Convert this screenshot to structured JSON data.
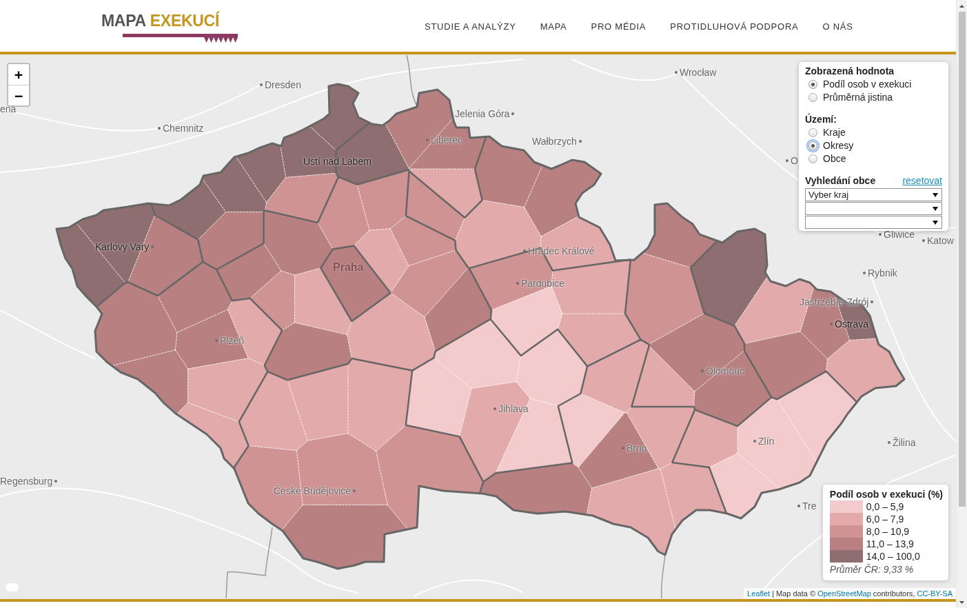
{
  "header": {
    "logo": {
      "first_word": "MAPA",
      "second_word": "EXEKUCÍ"
    },
    "nav": [
      {
        "label": "STUDIE A ANALÝZY"
      },
      {
        "label": "MAPA"
      },
      {
        "label": "PRO MÉDIA"
      },
      {
        "label": "PROTIDLUHOVÁ PODPORA"
      },
      {
        "label": "O NÁS"
      }
    ]
  },
  "map": {
    "zoom_controls": [
      {
        "label": "+"
      },
      {
        "label": "−"
      }
    ],
    "labels": [
      {
        "text": "Wrocław",
        "kind": "city"
      },
      {
        "text": "Dresden",
        "kind": "city"
      },
      {
        "text": "ena",
        "kind": "city"
      },
      {
        "text": "Jelenia Góra",
        "kind": "city"
      },
      {
        "text": "Chemnitz",
        "kind": "city"
      },
      {
        "text": "Liberec",
        "kind": "city"
      },
      {
        "text": "Wałbrzych",
        "kind": "city"
      },
      {
        "text": "O",
        "kind": "city"
      },
      {
        "text": "Ústí nad Labem",
        "kind": "city"
      },
      {
        "text": "Gliwice",
        "kind": "city"
      },
      {
        "text": "Katow",
        "kind": "city"
      },
      {
        "text": "Karlovy Vary",
        "kind": "city"
      },
      {
        "text": "Hradec Králové",
        "kind": "city"
      },
      {
        "text": "Praha",
        "kind": "capital"
      },
      {
        "text": "Rybnik",
        "kind": "city"
      },
      {
        "text": "Pardubice",
        "kind": "city"
      },
      {
        "text": "Jastrzębie-Zdrój",
        "kind": "city"
      },
      {
        "text": "Ostrava",
        "kind": "city"
      },
      {
        "text": "Plzeň",
        "kind": "city"
      },
      {
        "text": "Olomouc",
        "kind": "city"
      },
      {
        "text": "Jihlava",
        "kind": "city"
      },
      {
        "text": "Zlín",
        "kind": "city"
      },
      {
        "text": "Žilina",
        "kind": "city"
      },
      {
        "text": "Brno",
        "kind": "city"
      },
      {
        "text": "Regensburg",
        "kind": "city"
      },
      {
        "text": "České Budějovice",
        "kind": "city"
      },
      {
        "text": "Tre",
        "kind": "city"
      }
    ],
    "districts": [
      {
        "color": "#8f6e70"
      },
      {
        "color": "#8f6e70"
      },
      {
        "color": "#b98082"
      },
      {
        "color": "#8f6e70"
      },
      {
        "color": "#8f6e70"
      },
      {
        "color": "#8f6e70"
      },
      {
        "color": "#8f6e70"
      },
      {
        "color": "#8f6e70"
      },
      {
        "color": "#b98082"
      },
      {
        "color": "#d09394"
      },
      {
        "color": "#8f6e70"
      },
      {
        "color": "#b98082"
      },
      {
        "color": "#b98082"
      },
      {
        "color": "#e3aaab"
      },
      {
        "color": "#d09394"
      },
      {
        "color": "#b98082"
      },
      {
        "color": "#b98082"
      },
      {
        "color": "#e3aaab"
      },
      {
        "color": "#e3aaab"
      },
      {
        "color": "#d09394"
      },
      {
        "color": "#f4cbcc"
      },
      {
        "color": "#e3aaab"
      },
      {
        "color": "#e3aaab"
      },
      {
        "color": "#b98082"
      },
      {
        "color": "#b98082"
      },
      {
        "color": "#d09394"
      },
      {
        "color": "#d09394"
      },
      {
        "color": "#d09394"
      },
      {
        "color": "#e3aaab"
      },
      {
        "color": "#e3aaab"
      },
      {
        "color": "#d09394"
      },
      {
        "color": "#d09394"
      },
      {
        "color": "#b98082"
      },
      {
        "color": "#e3aaab"
      },
      {
        "color": "#b98082"
      },
      {
        "color": "#b98082"
      },
      {
        "color": "#b98082"
      },
      {
        "color": "#b98082"
      },
      {
        "color": "#b98082"
      },
      {
        "color": "#b98082"
      },
      {
        "color": "#e3aaab"
      },
      {
        "color": "#e3aaab"
      },
      {
        "color": "#e3aaab"
      },
      {
        "color": "#e3aaab"
      },
      {
        "color": "#e3aaab"
      },
      {
        "color": "#e3aaab"
      },
      {
        "color": "#d09394"
      },
      {
        "color": "#d09394"
      },
      {
        "color": "#b98082"
      },
      {
        "color": "#d09394"
      },
      {
        "color": "#f4cbcc"
      },
      {
        "color": "#f4cbcc"
      },
      {
        "color": "#e3aaab"
      },
      {
        "color": "#f4cbcc"
      },
      {
        "color": "#f4cbcc"
      },
      {
        "color": "#b98082"
      },
      {
        "color": "#f4cbcc"
      },
      {
        "color": "#b98082"
      },
      {
        "color": "#e3aaab"
      },
      {
        "color": "#e3aaab"
      },
      {
        "color": "#e3aaab"
      },
      {
        "color": "#e3aaab"
      },
      {
        "color": "#b98082"
      },
      {
        "color": "#d09394"
      },
      {
        "color": "#b98082"
      },
      {
        "color": "#e3aaab"
      },
      {
        "color": "#b98082"
      },
      {
        "color": "#8f6e70"
      },
      {
        "color": "#e3aaab"
      },
      {
        "color": "#b98082"
      },
      {
        "color": "#8f6e70"
      },
      {
        "color": "#b98082"
      },
      {
        "color": "#e3aaab"
      },
      {
        "color": "#e3aaab"
      },
      {
        "color": "#f4cbcc"
      },
      {
        "color": "#f4cbcc"
      },
      {
        "color": "#f4cbcc"
      }
    ],
    "attribution": [
      {
        "kind": "link",
        "text": "Leaflet"
      },
      {
        "kind": "text",
        "text": " | Map data © "
      },
      {
        "kind": "link",
        "text": "OpenStreetMap"
      },
      {
        "kind": "text",
        "text": " contributors, "
      },
      {
        "kind": "link",
        "text": "CC-BY-SA"
      }
    ]
  },
  "control_panel": {
    "display": {
      "title": "Zobrazená hodnota",
      "options": [
        {
          "label": "Podíl osob v exekuci",
          "selected": true
        },
        {
          "label": "Průměrná jistina",
          "selected": false
        }
      ]
    },
    "territory": {
      "title": "Území:",
      "options": [
        {
          "label": "Kraje",
          "selected": false,
          "focused": false
        },
        {
          "label": "Okresy",
          "selected": true,
          "focused": true
        },
        {
          "label": "Obce",
          "selected": false,
          "focused": false
        }
      ]
    },
    "search": {
      "title": "Vyhledání obce",
      "reset_link": "resetovat",
      "dropdowns": [
        {
          "kind": "dropdown",
          "value": "Vyber kraj"
        },
        {
          "kind": "dropdown"
        },
        {
          "kind": "dropdown"
        }
      ]
    }
  },
  "legend": {
    "title": "Podíl osob v exekuci (%)",
    "items": [
      {
        "range": "0,0 – 5,9",
        "color": "#f4cbcc"
      },
      {
        "range": "6,0 – 7,9",
        "color": "#e3aaab"
      },
      {
        "range": "8,0 – 10,9",
        "color": "#d09394"
      },
      {
        "range": "11,0 – 13,9",
        "color": "#b98082"
      },
      {
        "range": "14,0 – 100,0",
        "color": "#8f6e70"
      }
    ],
    "average": "Průměr ČR: 9,33 %"
  }
}
